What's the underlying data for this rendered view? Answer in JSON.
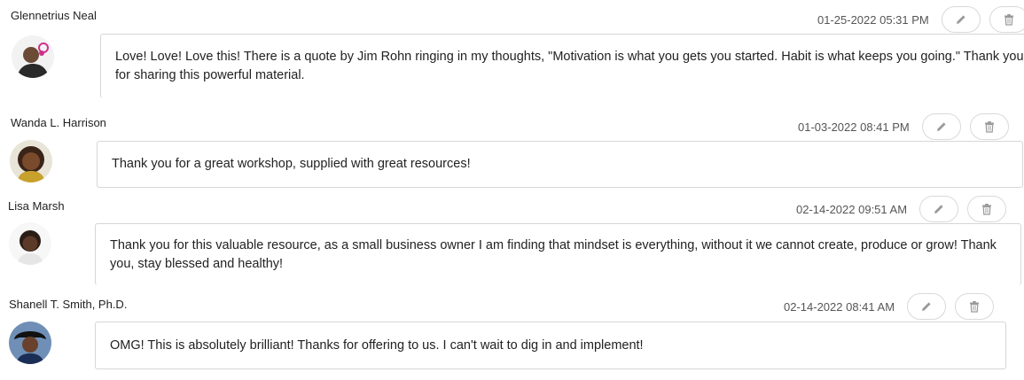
{
  "comments": [
    {
      "author": "Glennetrius Neal",
      "date": "01-25-2022 05:31 PM",
      "text": "Love! Love! Love this! There is a quote by Jim Rohn ringing in my thoughts, \"Motivation is what you gets you started. Habit is what keeps you going.\" Thank you for sharing this powerful material.",
      "edit_icon": "pencil-icon",
      "delete_icon": "trash-icon"
    },
    {
      "author": "Wanda L. Harrison",
      "date": "01-03-2022 08:41 PM",
      "text": "Thank you for a great workshop, supplied with great resources!",
      "edit_icon": "pencil-icon",
      "delete_icon": "trash-icon"
    },
    {
      "author": "Lisa Marsh",
      "date": "02-14-2022 09:51 AM",
      "text": "Thank you for this valuable resource, as a small business owner I am finding that mindset is everything, without it we cannot create, produce or grow!  Thank you, stay blessed and healthy!",
      "edit_icon": "pencil-icon",
      "delete_icon": "trash-icon"
    },
    {
      "author": "Shanell T. Smith, Ph.D.",
      "date": "02-14-2022 08:41 AM",
      "text": "OMG! This is absolutely brilliant! Thanks for offering to us. I can't wait to dig in and implement!",
      "edit_icon": "pencil-icon",
      "delete_icon": "trash-icon"
    }
  ],
  "colors": {
    "border": "#d6d6d6",
    "button_border": "#d9d9d9",
    "icon": "#9a9a9a",
    "text": "#222222",
    "date": "#555555"
  }
}
